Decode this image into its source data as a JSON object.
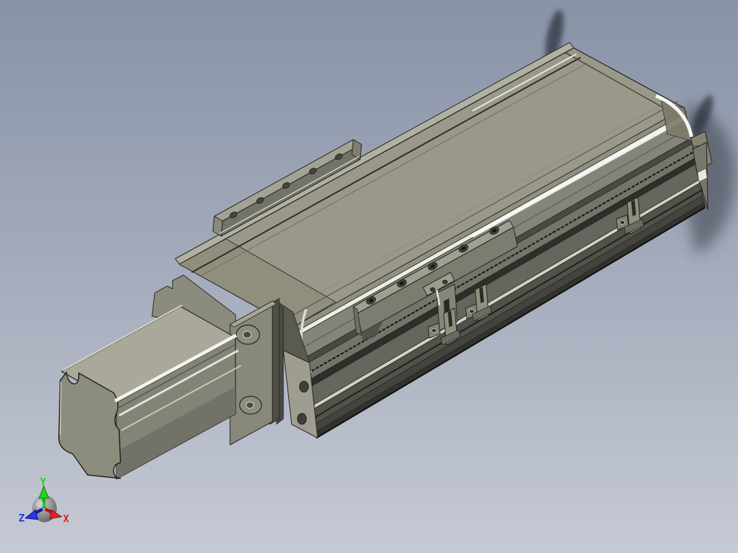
{
  "app": {
    "name": "cad-3d-viewport",
    "view": "isometric"
  },
  "viewport": {
    "background_top": "#8893a7",
    "background_mid": "#a8afbe",
    "background_bottom": "#c5cad4",
    "shadow_color": "#363c46"
  },
  "model": {
    "name": "linear-actuator-stage",
    "description": "ballscrew linear motion stage with stepper motor, carriage and limit sensors",
    "palette": {
      "top_face": "#999889",
      "chamfer_face": "#8f8f82",
      "side_face": "#84847a",
      "dark_groove": "#2e2e2a",
      "base_face": "#52524b",
      "motor_face": "#8d8d7e",
      "edge_line": "#23231e",
      "highlight": "#f2f2ec"
    },
    "parts": [
      {
        "name": "motor-housing"
      },
      {
        "name": "motor-flange"
      },
      {
        "name": "motor-mount-bracket"
      },
      {
        "name": "body-extrusion"
      },
      {
        "name": "top-table"
      },
      {
        "name": "rear-mounting-rail"
      },
      {
        "name": "carriage-block"
      },
      {
        "name": "sensor-dog-bracket"
      },
      {
        "name": "limit-sensor-1"
      },
      {
        "name": "limit-sensor-2"
      },
      {
        "name": "limit-sensor-3"
      },
      {
        "name": "end-cap"
      },
      {
        "name": "base-end-face"
      }
    ]
  },
  "triad": {
    "name": "orientation-triad",
    "axes": [
      {
        "label": "Y",
        "color": "#21d421",
        "direction": "up"
      },
      {
        "label": "Z",
        "color": "#2936e8",
        "direction": "lower-left"
      },
      {
        "label": "X",
        "color": "#e02525",
        "direction": "lower-right"
      }
    ]
  }
}
